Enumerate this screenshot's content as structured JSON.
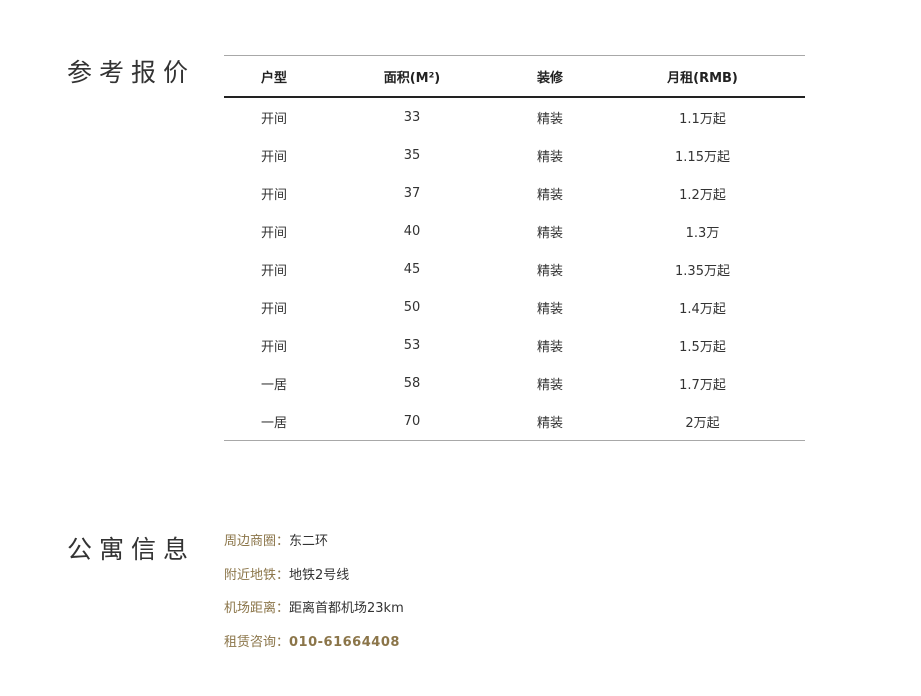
{
  "price_section": {
    "title": "参考报价",
    "table": {
      "headers": [
        "户型",
        "面积(M²)",
        "装修",
        "月租(RMB)"
      ],
      "rows": [
        [
          "开间",
          "33",
          "精装",
          "1.1万起"
        ],
        [
          "开间",
          "35",
          "精装",
          "1.15万起"
        ],
        [
          "开间",
          "37",
          "精装",
          "1.2万起"
        ],
        [
          "开间",
          "40",
          "精装",
          "1.3万"
        ],
        [
          "开间",
          "45",
          "精装",
          "1.35万起"
        ],
        [
          "开间",
          "50",
          "精装",
          "1.4万起"
        ],
        [
          "开间",
          "53",
          "精装",
          "1.5万起"
        ],
        [
          "一居",
          "58",
          "精装",
          "1.7万起"
        ],
        [
          "一居",
          "70",
          "精装",
          "2万起"
        ]
      ]
    }
  },
  "info_section": {
    "title": "公寓信息",
    "items": [
      {
        "label": "周边商圈：",
        "value": "东二环"
      },
      {
        "label": "附近地铁：",
        "value": "地铁2号线"
      },
      {
        "label": "机场距离：",
        "value": "距离首都机场23km"
      },
      {
        "label": "租赁咨询：",
        "value": "010-61664408"
      }
    ]
  },
  "colors": {
    "accent": "#8b7549",
    "text": "#333333",
    "rule": "#a8a8a8"
  }
}
